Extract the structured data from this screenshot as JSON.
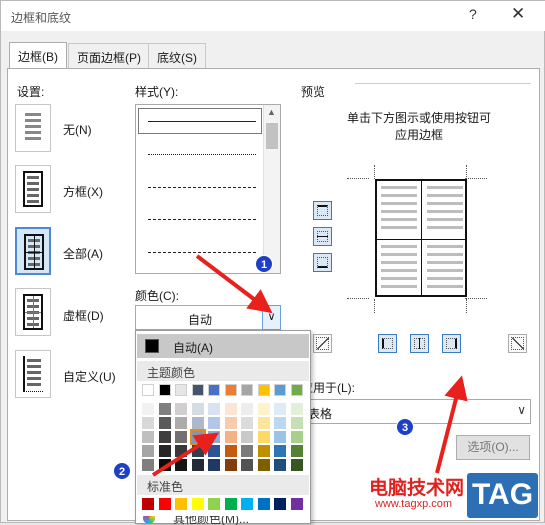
{
  "window": {
    "title": "边框和底纹",
    "help_icon": "?",
    "close_icon": "✕"
  },
  "tabs": [
    {
      "label": "边框(B)",
      "active": true
    },
    {
      "label": "页面边框(P)",
      "active": false
    },
    {
      "label": "底纹(S)",
      "active": false
    }
  ],
  "setting": {
    "label": "设置:",
    "options": [
      {
        "label": "无(N)",
        "icon": "border-none-icon",
        "selected": false
      },
      {
        "label": "方框(X)",
        "icon": "border-box-icon",
        "selected": false
      },
      {
        "label": "全部(A)",
        "icon": "border-all-icon",
        "selected": true
      },
      {
        "label": "虚框(D)",
        "icon": "border-grid-icon",
        "selected": false
      },
      {
        "label": "自定义(U)",
        "icon": "border-custom-icon",
        "selected": false
      }
    ]
  },
  "style": {
    "label": "样式(Y):",
    "lines": [
      "solid",
      "dotted",
      "dashed-small",
      "dashed",
      "dash-dot"
    ]
  },
  "color": {
    "label": "颜色(C):",
    "value": "自动",
    "dropdown": {
      "auto_label": "自动(A)",
      "theme_header": "主题颜色",
      "standard_header": "标准色",
      "more_label": "其他颜色(M)...",
      "theme_top": [
        "#ffffff",
        "#000000",
        "#e7e6e6",
        "#44546a",
        "#4472c4",
        "#ed7d31",
        "#a5a5a5",
        "#ffc000",
        "#5b9bd5",
        "#70ad47"
      ],
      "theme_shades": [
        [
          "#f2f2f2",
          "#7f7f7f",
          "#d0cece",
          "#d6dce4",
          "#d9e2f3",
          "#fbe5d5",
          "#ededed",
          "#fff2cc",
          "#deeaf6",
          "#e2efd9"
        ],
        [
          "#d8d8d8",
          "#595959",
          "#aeabab",
          "#adb9ca",
          "#b4c6e7",
          "#f7cbac",
          "#dbdbdb",
          "#fee599",
          "#bdd7ee",
          "#c5e0b3"
        ],
        [
          "#bfbfbf",
          "#3f3f3f",
          "#757070",
          "#8496b0",
          "#8eaadb",
          "#f4b183",
          "#c9c9c9",
          "#ffd965",
          "#9cc3e5",
          "#a8d08d"
        ],
        [
          "#a5a5a5",
          "#262626",
          "#3a3838",
          "#323f4f",
          "#2f5496",
          "#c55a11",
          "#7b7b7b",
          "#bf9000",
          "#2e75b5",
          "#538135"
        ],
        [
          "#7f7f7f",
          "#0c0c0c",
          "#171616",
          "#222a35",
          "#1f3864",
          "#833c0b",
          "#525252",
          "#7f6000",
          "#1e4e79",
          "#375623"
        ]
      ],
      "standard": [
        "#c00000",
        "#ff0000",
        "#ffc000",
        "#ffff00",
        "#92d050",
        "#00b050",
        "#00b0f0",
        "#0070c0",
        "#002060",
        "#7030a0"
      ],
      "selected_color": "#8496b0"
    }
  },
  "preview": {
    "label": "预览",
    "hint_line1": "单击下方图示或使用按钮可",
    "hint_line2": "应用边框"
  },
  "apply_to": {
    "label": "应用于(L):",
    "value": "表格"
  },
  "options_button": "选项(O)...",
  "badges": [
    "1",
    "2",
    "3"
  ],
  "watermark": {
    "text": "电脑技术网",
    "url": "www.tagxp.com",
    "tag": "TAG"
  }
}
